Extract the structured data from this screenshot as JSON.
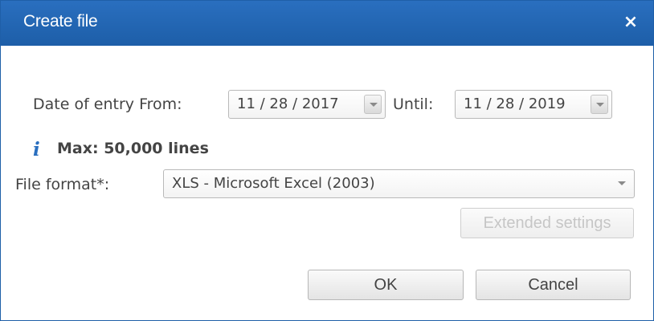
{
  "dialog": {
    "title": "Create file",
    "close_label": "×"
  },
  "date_range": {
    "label": "Date of entry From:",
    "from_value": "11 / 28 / 2017",
    "until_label": "Until:",
    "until_value": "11 / 28 / 2019"
  },
  "info": {
    "icon": "i",
    "max_text": "Max: 50,000 lines"
  },
  "file_format": {
    "label": "File format*:",
    "value": "XLS - Microsoft Excel (2003)"
  },
  "buttons": {
    "extended_settings": "Extended settings",
    "ok": "OK",
    "cancel": "Cancel"
  }
}
